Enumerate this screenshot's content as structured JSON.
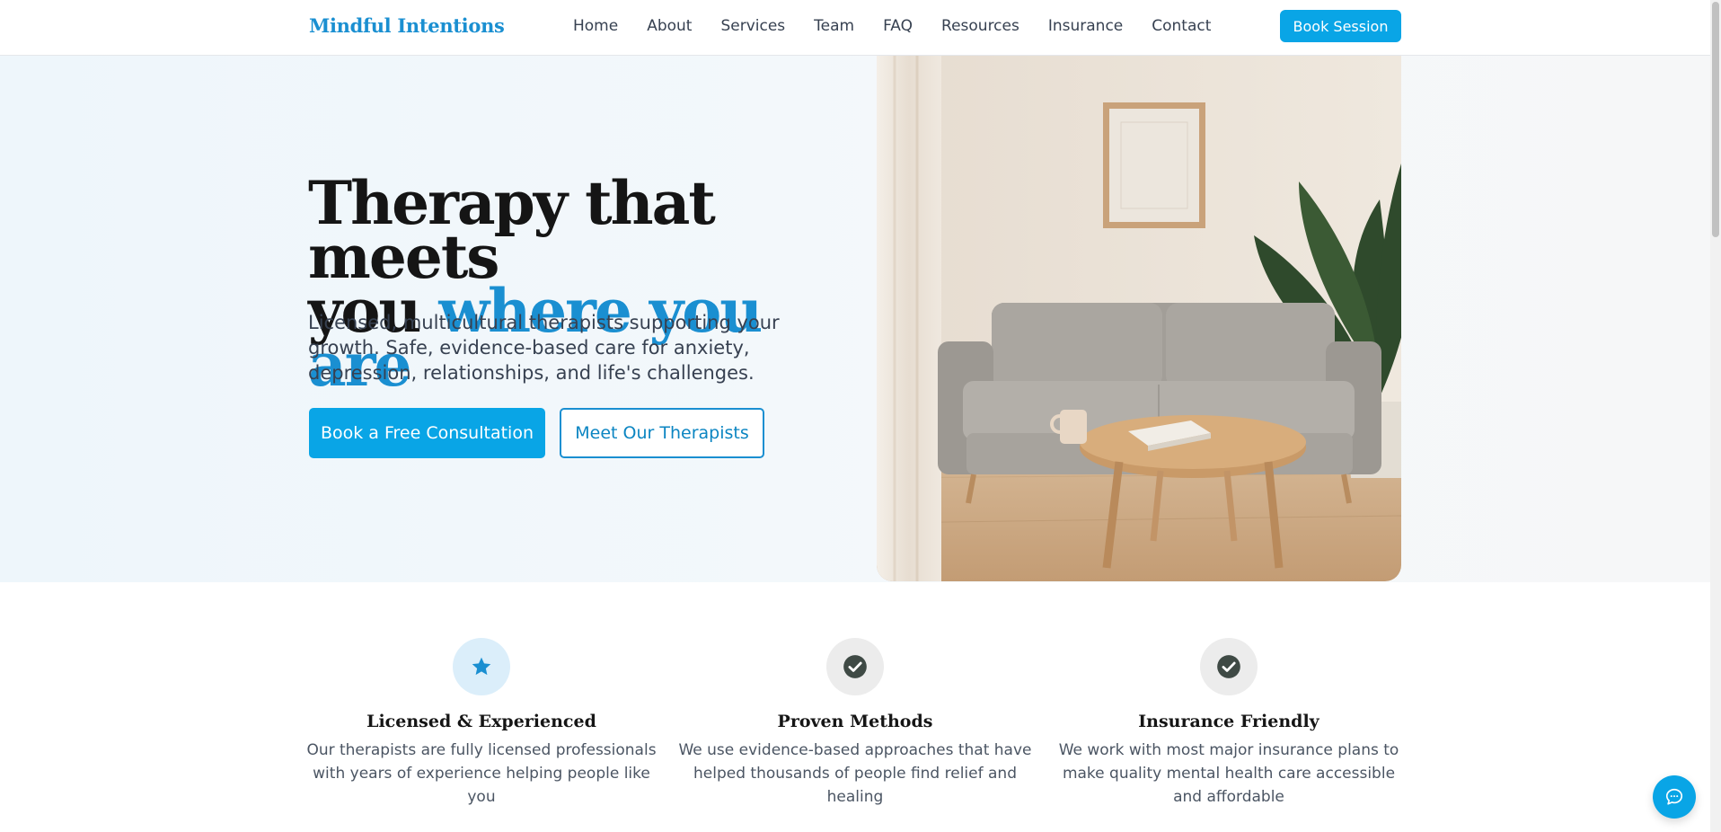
{
  "header": {
    "brand": "Mindful Intentions",
    "nav": [
      "Home",
      "About",
      "Services",
      "Team",
      "FAQ",
      "Resources",
      "Insurance",
      "Contact"
    ],
    "cta_label": "Book Session"
  },
  "hero": {
    "title_line1": "Therapy that meets",
    "title_line2_plain": "you",
    "title_line2_accent": "where you are",
    "subtitle": "Licensed, multicultural therapists supporting your growth. Safe, evidence-based care for anxiety, depression, relationships, and life's challenges.",
    "primary_button": "Book a Free Consultation",
    "secondary_button": "Meet Our Therapists"
  },
  "features": [
    {
      "icon": "star-icon",
      "title": "Licensed & Experienced",
      "text": "Our therapists are fully licensed professionals with years of experience helping people like you"
    },
    {
      "icon": "check-circle-icon",
      "title": "Proven Methods",
      "text": "We use evidence-based approaches that have helped thousands of people find relief and healing"
    },
    {
      "icon": "check-circle-icon",
      "title": "Insurance Friendly",
      "text": "We work with most major insurance plans to make quality mental health care accessible and affordable"
    }
  ],
  "colors": {
    "accent": "#1a8fd1",
    "button": "#09a5e6",
    "heading": "#151515"
  }
}
